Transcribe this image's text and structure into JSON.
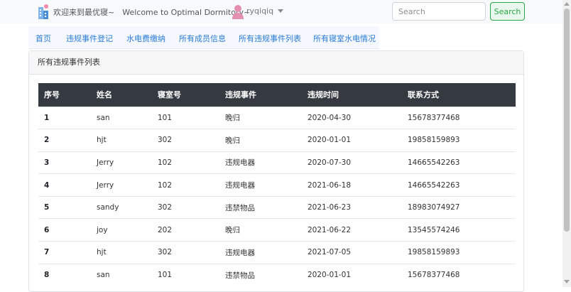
{
  "navbar": {
    "welcome": "欢迎来到最优寝~　Welcome to Optimal Dormitory~",
    "username": "ryqiqiq",
    "search_placeholder": "Search",
    "search_button": "Search"
  },
  "tabs": [
    {
      "label": "首页"
    },
    {
      "label": "违规事件登记"
    },
    {
      "label": "水电费缴纳"
    },
    {
      "label": "所有成员信息"
    },
    {
      "label": "所有违规事件列表"
    },
    {
      "label": "所有寝室水电情况"
    }
  ],
  "card": {
    "title": "所有违规事件列表"
  },
  "table": {
    "headers": [
      "序号",
      "姓名",
      "寝室号",
      "违规事件",
      "违规时间",
      "联系方式"
    ],
    "rows": [
      [
        "1",
        "san",
        "101",
        "晚归",
        "2020-04-30",
        "15678377468"
      ],
      [
        "2",
        "hjt",
        "302",
        "晚归",
        "2020-01-01",
        "19858159893"
      ],
      [
        "3",
        "Jerry",
        "102",
        "违规电器",
        "2020-07-30",
        "14665542263"
      ],
      [
        "4",
        "Jerry",
        "102",
        "违规电器",
        "2021-06-18",
        "14665542263"
      ],
      [
        "5",
        "sandy",
        "302",
        "违禁物品",
        "2021-06-23",
        "18983074927"
      ],
      [
        "6",
        "joy",
        "202",
        "晚归",
        "2021-06-22",
        "13545574246"
      ],
      [
        "7",
        "hjt",
        "302",
        "违规电器",
        "2021-07-05",
        "19858159893"
      ],
      [
        "8",
        "san",
        "101",
        "违禁物品",
        "2020-01-01",
        "15678377468"
      ]
    ]
  },
  "colors": {
    "header_bg": "#343a40",
    "tab_link": "#2a7bd4",
    "search_accent": "#28a745"
  },
  "icons": {
    "logo": "building-logo-icon",
    "avatar": "user-avatar-icon",
    "dropdown": "caret-down-icon"
  }
}
